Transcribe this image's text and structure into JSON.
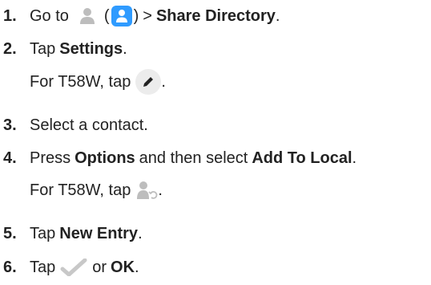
{
  "steps": [
    {
      "num": "1.",
      "pre": "Go to",
      "open_paren": "(",
      "close_paren": ")",
      "sep": ">",
      "bold": "Share Directory",
      "end": "."
    },
    {
      "num": "2.",
      "pre": "Tap",
      "bold": "Settings",
      "end": ".",
      "note": "For T58W, tap",
      "note_end": "."
    },
    {
      "num": "3.",
      "text": "Select a contact."
    },
    {
      "num": "4.",
      "pre": "Press",
      "bold": "Options",
      "mid": "and then select",
      "bold2": "Add To Local",
      "end": ".",
      "note": "For T58W, tap",
      "note_end": "."
    },
    {
      "num": "5.",
      "pre": "Tap",
      "bold": "New Entry",
      "end": "."
    },
    {
      "num": "6.",
      "pre": "Tap",
      "mid": "or",
      "bold": "OK",
      "end": "."
    }
  ],
  "icons": {
    "contacts_gray": "contact-person-icon",
    "contacts_app": "contacts-app-icon",
    "edit": "pencil-edit-icon",
    "add_to_local": "contact-sync-icon",
    "checkmark": "checkmark-icon"
  },
  "colors": {
    "text": "#222222",
    "icon_gray": "#bdbdbd",
    "app_blue": "#2f9bff",
    "edit_circle": "#ececec",
    "check_gray": "#c8c8c8"
  }
}
